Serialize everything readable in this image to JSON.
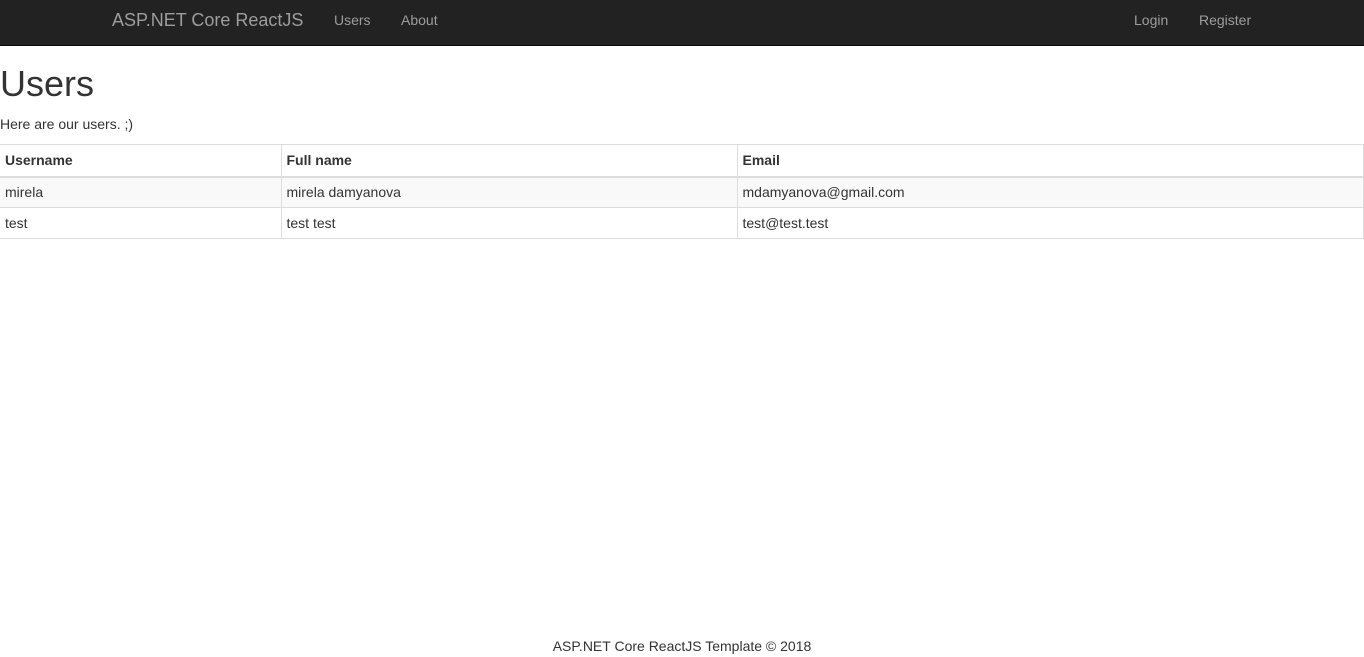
{
  "navbar": {
    "brand": "ASP.NET Core ReactJS",
    "left_links": [
      "Users",
      "About"
    ],
    "right_links": [
      "Login",
      "Register"
    ]
  },
  "main": {
    "title": "Users",
    "intro": "Here are our users. ;)",
    "table": {
      "headers": [
        "Username",
        "Full name",
        "Email"
      ],
      "rows": [
        [
          "mirela",
          "mirela damyanova",
          "mdamyanova@gmail.com"
        ],
        [
          "test",
          "test test",
          "test@test.test"
        ]
      ]
    }
  },
  "footer": {
    "text": "ASP.NET Core ReactJS Template © 2018"
  },
  "colors": {
    "navbar_bg": "#222222",
    "nav_text": "#9d9d9d",
    "body_text": "#333333",
    "table_border": "#dddddd",
    "striped_row": "#f9f9f9"
  }
}
